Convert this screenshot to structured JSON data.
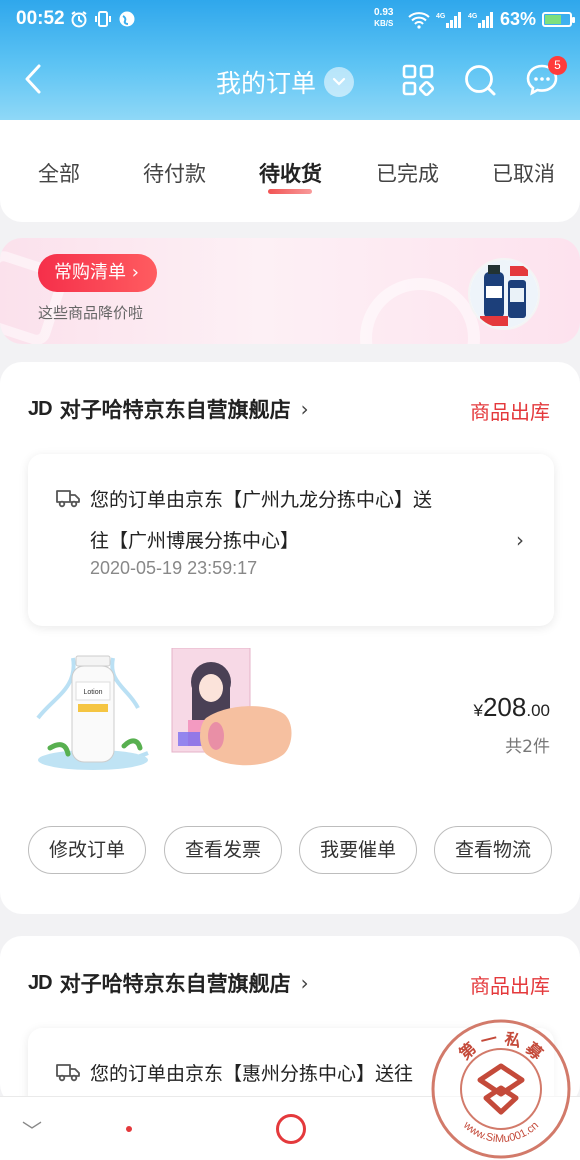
{
  "status_bar": {
    "time": "00:52",
    "net_speed": "0.93",
    "net_unit": "KB/S",
    "battery": "63%"
  },
  "nav": {
    "title": "我的订单",
    "message_badge": "5"
  },
  "tabs": [
    {
      "label": "全部",
      "active": false
    },
    {
      "label": "待付款",
      "active": false
    },
    {
      "label": "待收货",
      "active": true
    },
    {
      "label": "已完成",
      "active": false
    },
    {
      "label": "已取消",
      "active": false
    }
  ],
  "promo": {
    "pill_label": "常购清单 ›",
    "subtitle": "这些商品降价啦"
  },
  "orders": [
    {
      "shop_prefix": "JD",
      "shop_name": "对子哈特京东自营旗舰店",
      "status": "商品出库",
      "tracking_line1": "您的订单由京东【广州九龙分拣中心】送",
      "tracking_line2": "往【广州博展分拣中心】",
      "tracking_time": "2020-05-19 23:59:17",
      "price_symbol": "¥",
      "price_int": "208",
      "price_dec": ".00",
      "quantity": "共2件",
      "actions": [
        "修改订单",
        "查看发票",
        "我要催单",
        "查看物流"
      ]
    },
    {
      "shop_prefix": "JD",
      "shop_name": "对子哈特京东自营旗舰店",
      "status": "商品出库",
      "tracking_line1": "您的订单由京东【惠州分拣中心】送往"
    }
  ],
  "watermark": {
    "text_top": "第 一 私 募",
    "text_bottom": "www.SiMu001.cn"
  },
  "colors": {
    "accent_red": "#e4393c",
    "header_blue": "#2fa7ec"
  }
}
